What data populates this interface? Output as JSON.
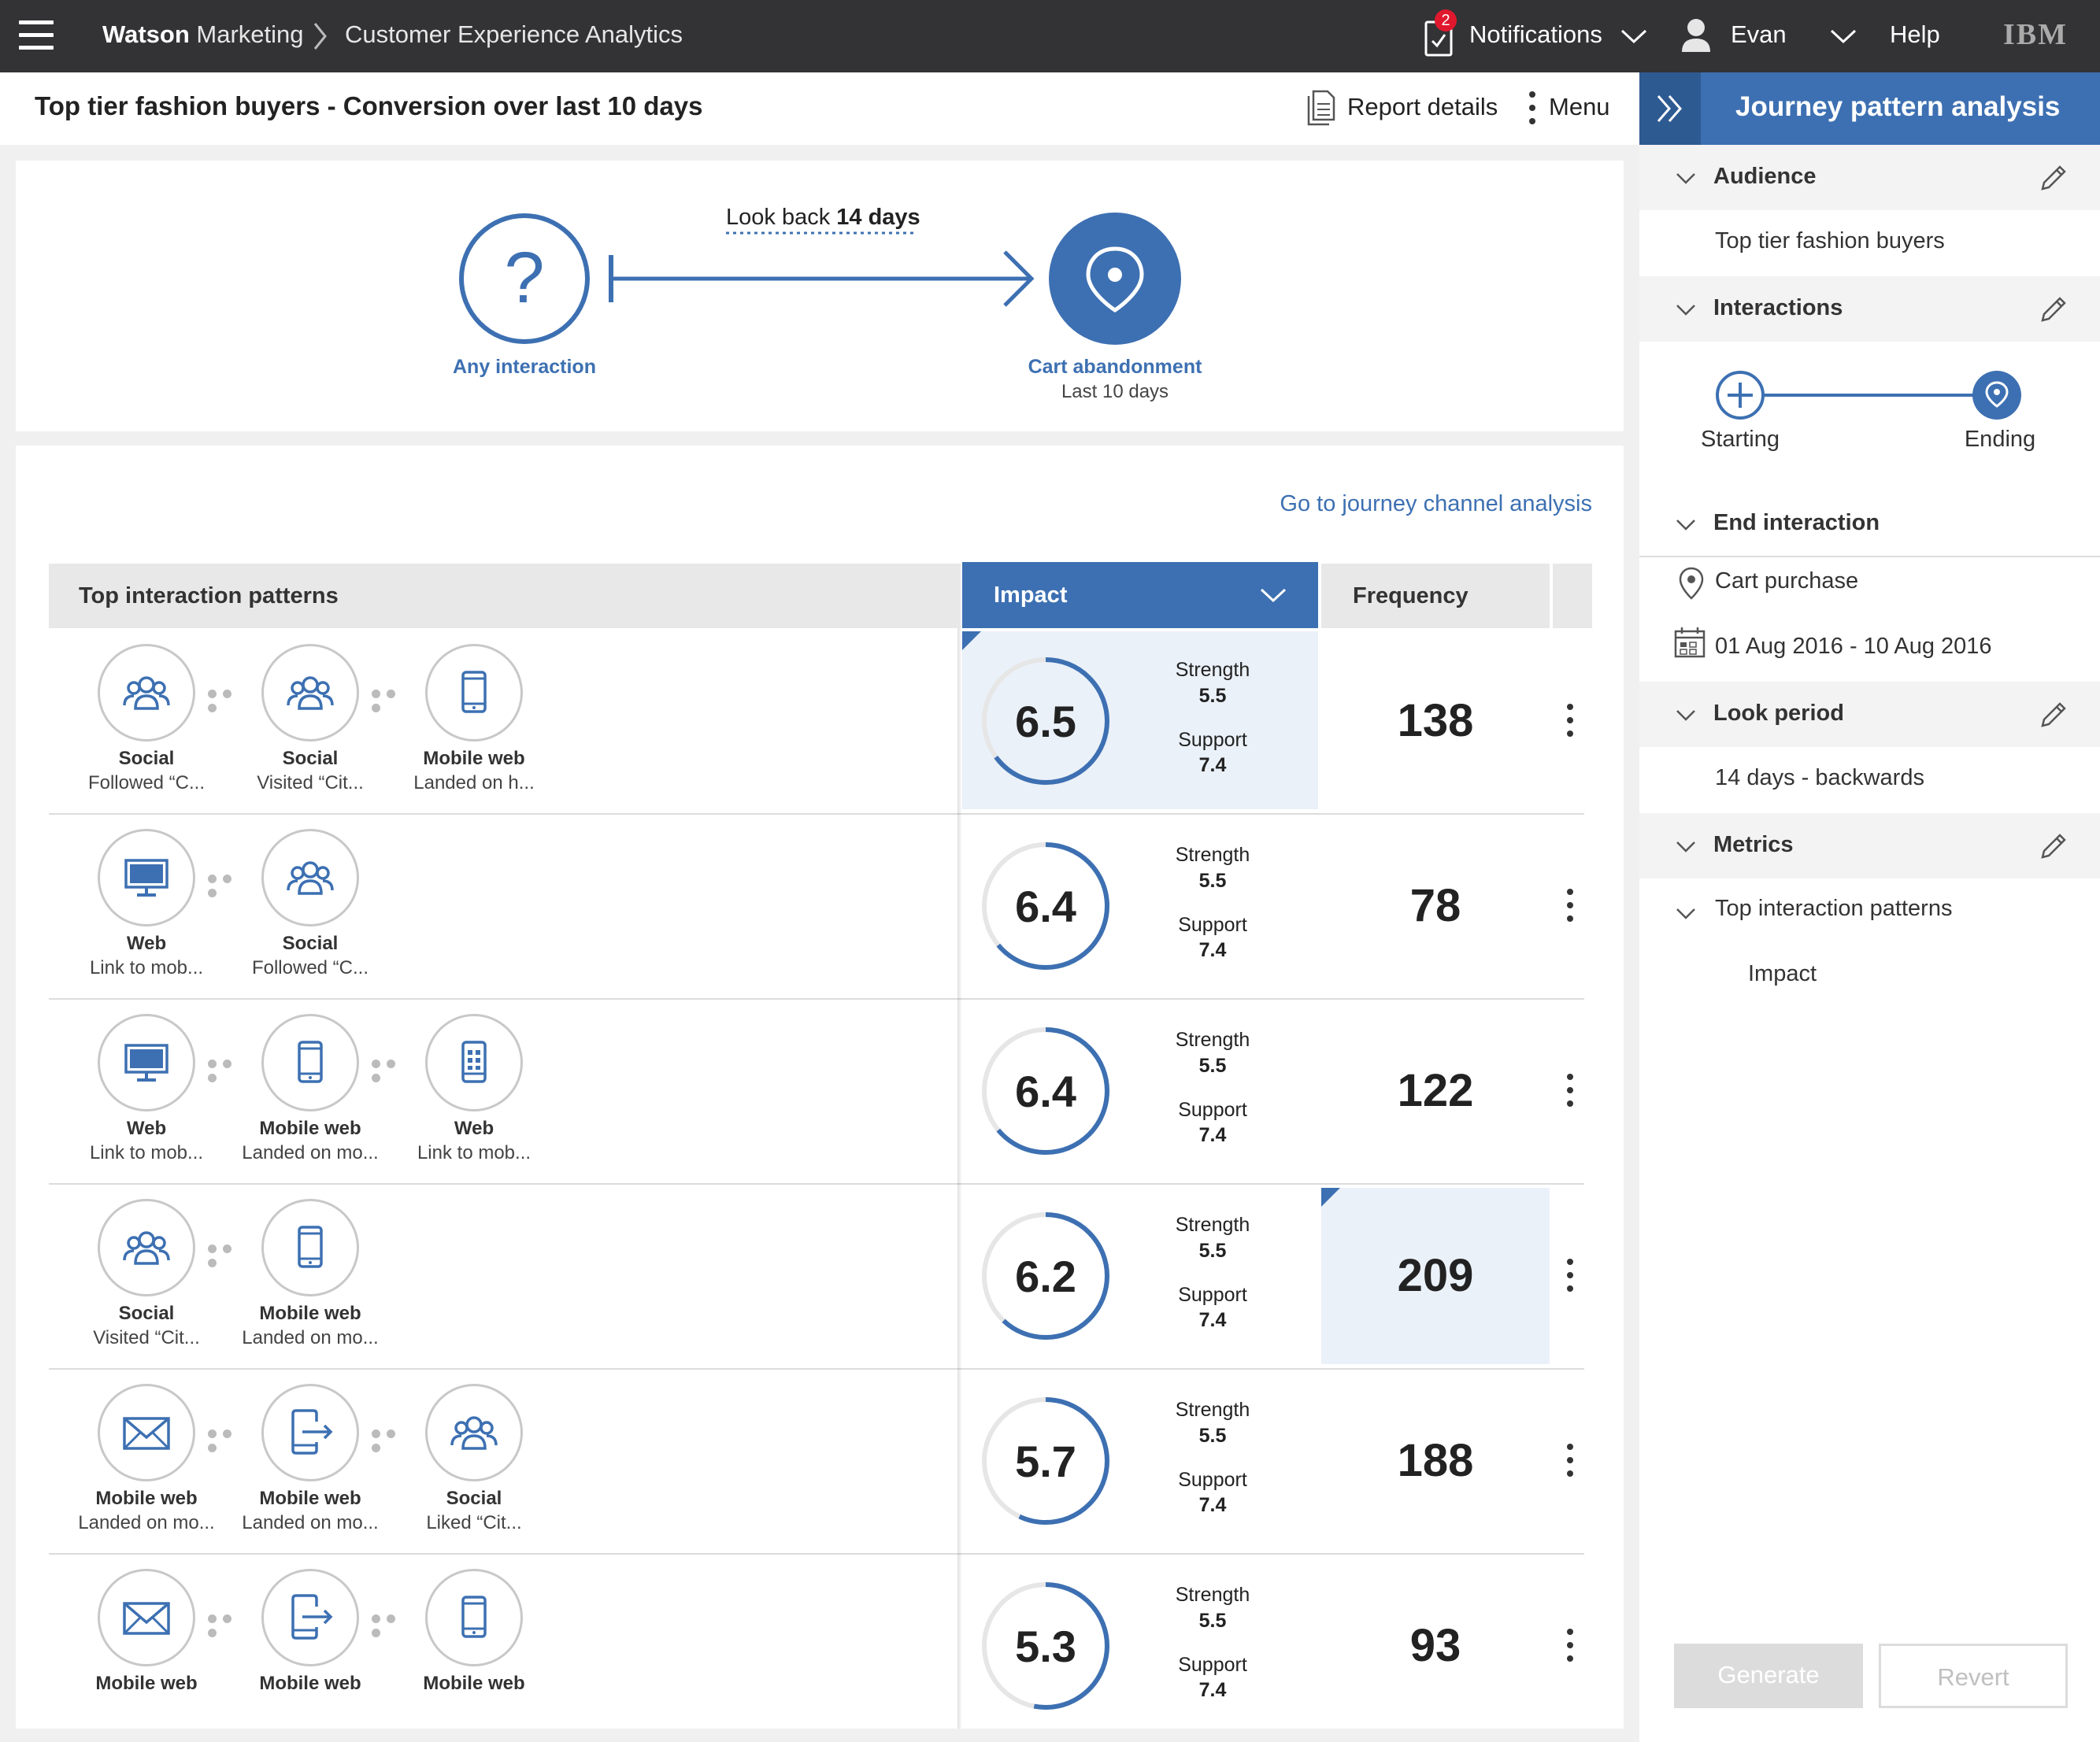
{
  "topbar": {
    "brand_bold": "Watson",
    "brand_rest": " Marketing",
    "breadcrumb": "Customer Experience Analytics",
    "notifications_count": "2",
    "notifications": "Notifications",
    "user": "Evan",
    "help": "Help",
    "logo": "IBM"
  },
  "header": {
    "title": "Top tier fashion buyers - Conversion over last 10 days",
    "report_details": "Report details",
    "menu": "Menu"
  },
  "flow": {
    "lookback_prefix": "Look back ",
    "lookback_value": "14 days",
    "start_label": "Any interaction",
    "end_label": "Cart abandonment",
    "end_sub": "Last 10 days"
  },
  "table": {
    "link": "Go to journey channel analysis",
    "col_patterns": "Top interaction patterns",
    "col_impact": "Impact",
    "col_frequency": "Frequency",
    "strength_label": "Strength",
    "support_label": "Support",
    "rows": [
      {
        "impact": "6.5",
        "impact_fraction": 0.65,
        "strength": "5.5",
        "support": "7.4",
        "frequency": "138",
        "highlight": "impact",
        "steps": [
          {
            "icon": "social-icon",
            "label": "Social",
            "sub": "Followed “C..."
          },
          {
            "icon": "social-icon",
            "label": "Social",
            "sub": "Visited “Cit..."
          },
          {
            "icon": "mobile-icon",
            "label": "Mobile web",
            "sub": "Landed on h..."
          }
        ]
      },
      {
        "impact": "6.4",
        "impact_fraction": 0.64,
        "strength": "5.5",
        "support": "7.4",
        "frequency": "78",
        "highlight": "",
        "steps": [
          {
            "icon": "monitor-icon",
            "label": "Web",
            "sub": "Link to mob..."
          },
          {
            "icon": "social-icon",
            "label": "Social",
            "sub": "Followed “C..."
          }
        ]
      },
      {
        "impact": "6.4",
        "impact_fraction": 0.64,
        "strength": "5.5",
        "support": "7.4",
        "frequency": "122",
        "highlight": "",
        "steps": [
          {
            "icon": "monitor-icon",
            "label": "Web",
            "sub": "Link to mob..."
          },
          {
            "icon": "mobile-icon",
            "label": "Mobile web",
            "sub": "Landed on mo..."
          },
          {
            "icon": "mobile-app-icon",
            "label": "Web",
            "sub": "Link to mob..."
          }
        ]
      },
      {
        "impact": "6.2",
        "impact_fraction": 0.62,
        "strength": "5.5",
        "support": "7.4",
        "frequency": "209",
        "highlight": "frequency",
        "steps": [
          {
            "icon": "social-icon",
            "label": "Social",
            "sub": "Visited “Cit..."
          },
          {
            "icon": "mobile-icon",
            "label": "Mobile web",
            "sub": "Landed on mo..."
          }
        ]
      },
      {
        "impact": "5.7",
        "impact_fraction": 0.57,
        "strength": "5.5",
        "support": "7.4",
        "frequency": "188",
        "highlight": "",
        "steps": [
          {
            "icon": "email-icon",
            "label": "Mobile web",
            "sub": "Landed on mo..."
          },
          {
            "icon": "mobile-exit-icon",
            "label": "Mobile web",
            "sub": "Landed on mo..."
          },
          {
            "icon": "social-icon",
            "label": "Social",
            "sub": "Liked “Cit..."
          }
        ]
      },
      {
        "impact": "5.3",
        "impact_fraction": 0.53,
        "strength": "5.5",
        "support": "7.4",
        "frequency": "93",
        "highlight": "",
        "steps": [
          {
            "icon": "email-icon",
            "label": "Mobile web",
            "sub": ""
          },
          {
            "icon": "mobile-exit-icon",
            "label": "Mobile web",
            "sub": ""
          },
          {
            "icon": "mobile-icon",
            "label": "Mobile web",
            "sub": ""
          }
        ]
      }
    ]
  },
  "panel": {
    "title": "Journey pattern analysis",
    "audience": "Audience",
    "audience_value": "Top tier fashion buyers",
    "interactions": "Interactions",
    "starting": "Starting",
    "ending": "Ending",
    "end_interaction": "End interaction",
    "cart_purchase": "Cart purchase",
    "date_range": "01 Aug 2016 - 10 Aug 2016",
    "look_period": "Look period",
    "look_value": "14 days - backwards",
    "metrics": "Metrics",
    "metrics_top": "Top interaction patterns",
    "metrics_impact": "Impact",
    "generate": "Generate",
    "revert": "Revert"
  },
  "colors": {
    "accent": "#3d70b2",
    "topbar": "#333335",
    "highlight": "#ebf1f9"
  }
}
